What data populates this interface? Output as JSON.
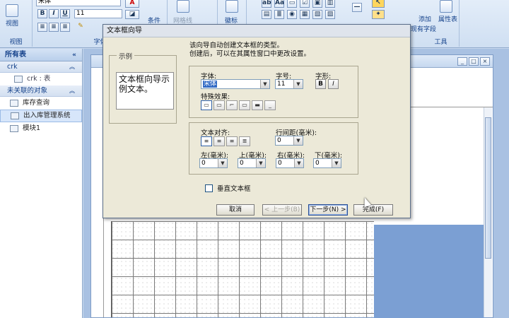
{
  "ribbon": {
    "view_label": "视图",
    "view_group_label": "视图",
    "font_name": "宋体",
    "font_size": "11",
    "font_group_label": "字体",
    "conditional_label": "条件",
    "gridlines_label": "网格线",
    "logo_label": "徽标",
    "add_field_label": "添加",
    "existing_fields_label": "现有字段",
    "property_sheet_label": "属性表",
    "tools_group_label": "工具"
  },
  "nav": {
    "header": "所有表",
    "sections": [
      {
        "title": "crk",
        "items": [
          {
            "label": "crk : 表",
            "selected": false
          }
        ]
      },
      {
        "title": "未关联的对象",
        "items": [
          {
            "label": "库存查询",
            "selected": false
          },
          {
            "label": "出入库管理系统",
            "selected": true
          },
          {
            "label": "模块1",
            "selected": false
          }
        ]
      }
    ]
  },
  "dialog": {
    "title": "文本框向导",
    "desc_line1": "该向导自动创建文本框的类型。",
    "desc_line2": "创建后，可以在其属性窗口中更改设置。",
    "sample_legend": "示例",
    "sample_text": "文本框向导示例文本。",
    "font_label": "字体:",
    "font_value": "宋体",
    "size_label": "字号:",
    "size_value": "11",
    "style_label": "字形:",
    "bold_label": "B",
    "italic_label": "I",
    "effects_label": "特殊效果:",
    "align_label": "文本对齐:",
    "line_spacing_label": "行间距(毫米):",
    "line_spacing_value": "0",
    "left_margin_label": "左(毫米):",
    "left_margin_value": "0",
    "top_margin_label": "上(毫米):",
    "top_margin_value": "0",
    "right_margin_label": "右(毫米):",
    "right_margin_value": "0",
    "bottom_margin_label": "下(毫米):",
    "bottom_margin_value": "0",
    "vertical_text_label": "垂直文本框",
    "vertical_text_checked": false,
    "cancel_label": "取消",
    "back_label": "< 上一步(B)",
    "next_label": "下一步(N) >",
    "finish_label": "完成(F)"
  },
  "colors": {
    "ribbon_bg": "#dbe7f6",
    "dialog_bg": "#ece9d8",
    "selection": "#316ac5",
    "workspace_blue": "#7b9fd3"
  }
}
